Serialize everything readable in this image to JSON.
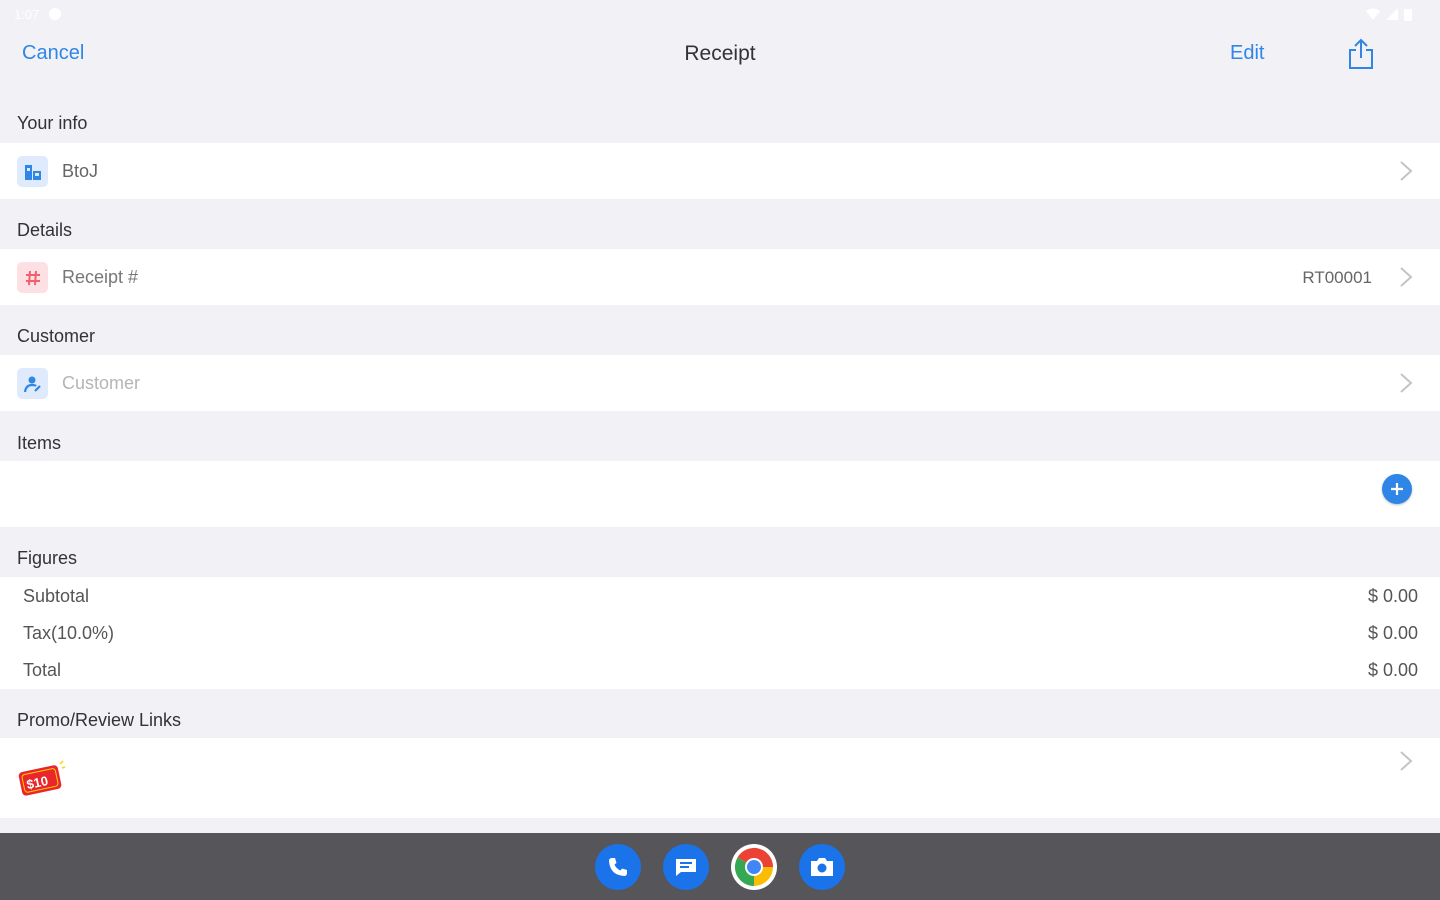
{
  "status_bar": {
    "time": "1:07"
  },
  "nav": {
    "cancel_label": "Cancel",
    "title": "Receipt",
    "edit_label": "Edit"
  },
  "sections": {
    "your_info": {
      "header": "Your info",
      "business_name": "BtoJ"
    },
    "details": {
      "header": "Details",
      "receipt_label": "Receipt #",
      "receipt_value": "RT00001"
    },
    "customer": {
      "header": "Customer",
      "placeholder": "Customer"
    },
    "items": {
      "header": "Items"
    },
    "figures": {
      "header": "Figures",
      "rows": [
        {
          "label": "Subtotal",
          "value": "$ 0.00"
        },
        {
          "label": "Tax(10.0%)",
          "value": "$ 0.00"
        },
        {
          "label": "Total",
          "value": "$ 0.00"
        }
      ]
    },
    "promo": {
      "header": "Promo/Review Links",
      "badge_text": "$10"
    }
  },
  "dock": {
    "apps": [
      "phone-icon",
      "messages-icon",
      "chrome-icon",
      "camera-icon"
    ]
  },
  "colors": {
    "accent": "#2f86e6",
    "background": "#f1f1f6",
    "dock": "#55555a"
  }
}
